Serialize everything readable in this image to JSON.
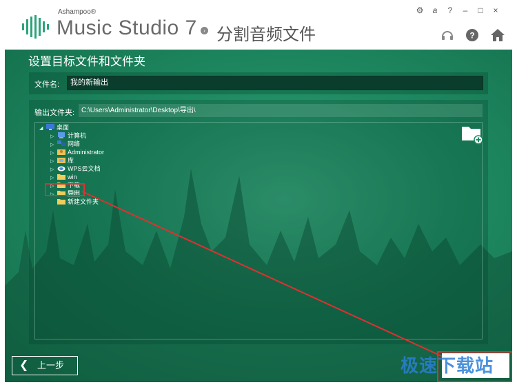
{
  "app": {
    "brand_small": "Ashampoo®",
    "brand_main": "Music Studio 7",
    "page_heading": "分割音频文件"
  },
  "window_controls": {
    "settings": "⚙",
    "font": "a",
    "help": "?",
    "minimize": "–",
    "maximize": "□",
    "close": "×"
  },
  "section": {
    "title": "设置目标文件和文件夹"
  },
  "filename": {
    "label": "文件名:",
    "value": "我的新输出"
  },
  "output_folder": {
    "label": "输出文件夹:",
    "path": "C:\\Users\\Administrator\\Desktop\\导出\\"
  },
  "tree": {
    "root": "桌面",
    "items": [
      {
        "label": "计算机",
        "icon": "computer-icon"
      },
      {
        "label": "网络",
        "icon": "network-icon"
      },
      {
        "label": "Administrator",
        "icon": "user-folder-icon"
      },
      {
        "label": "库",
        "icon": "library-icon"
      },
      {
        "label": "WPS云文档",
        "icon": "cloud-icon"
      },
      {
        "label": "win",
        "icon": "folder-icon"
      },
      {
        "label": "下载",
        "icon": "folder-icon"
      },
      {
        "label": "导出",
        "icon": "folder-icon"
      },
      {
        "label": "新建文件夹",
        "icon": "folder-icon"
      }
    ]
  },
  "nav": {
    "back_label": "上一步",
    "back_chevron": "❮"
  },
  "watermark": {
    "text": "极速下载站"
  },
  "colors": {
    "accent_green": "#1f8a62",
    "highlight_red": "#e03030",
    "watermark_blue": "#2b7fd6"
  }
}
